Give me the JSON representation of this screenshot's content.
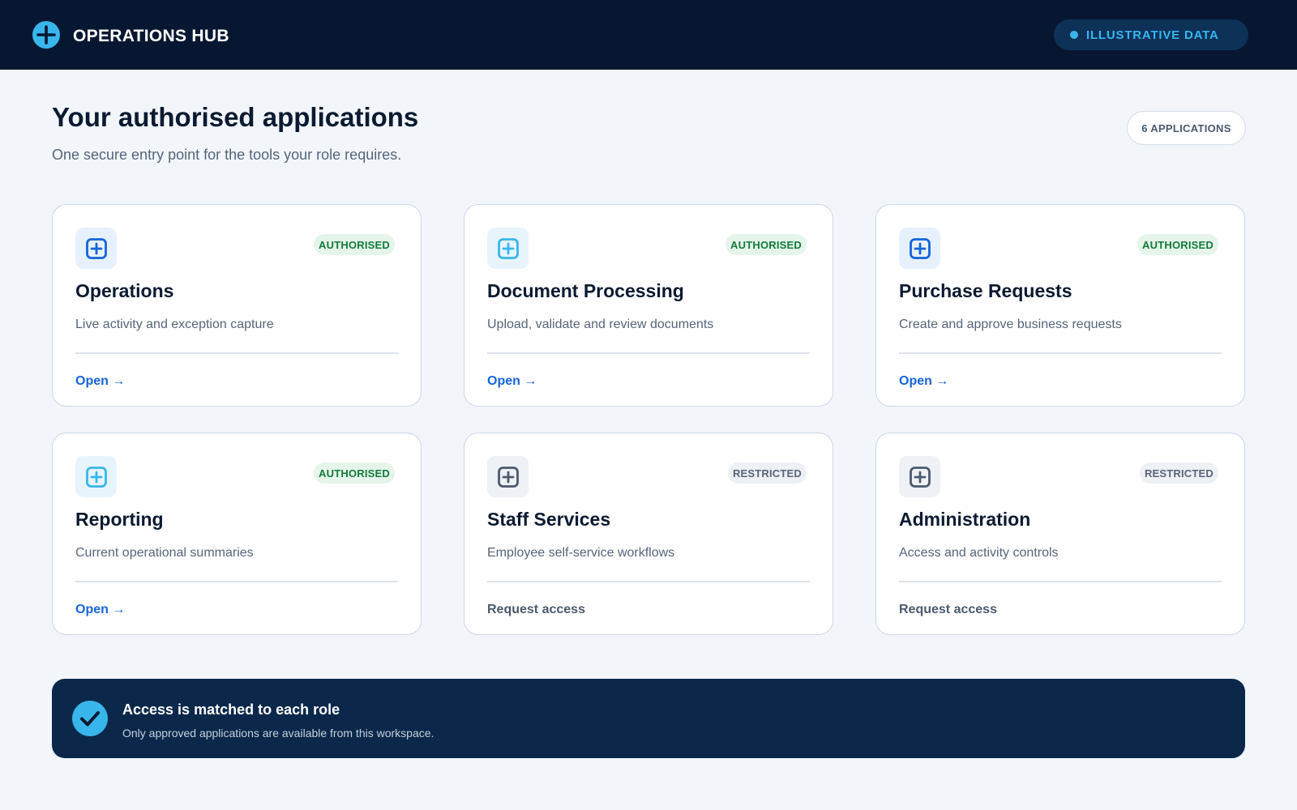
{
  "header": {
    "brand_icon": "plus-circle-icon",
    "brand_name": "OPERATIONS HUB",
    "data_badge": "ILLUSTRATIVE DATA"
  },
  "main": {
    "title": "Your authorised applications",
    "subtitle": "One secure entry point for the tools your role requires.",
    "count_badge": "6 APPLICATIONS"
  },
  "colors": {
    "header_bg": "#071731",
    "accent": "#38b6ec",
    "link": "#1565d8",
    "authorised_text": "#137a3c",
    "authorised_bg": "#e5f5ea",
    "restricted_text": "#5a6578",
    "restricted_bg": "#edf0f4",
    "notice_bg": "#0b284b"
  },
  "apps": [
    {
      "name": "Operations",
      "description": "Live activity and exception capture",
      "status": "AUTHORISED",
      "action": "Open →",
      "icon": "plus-square-icon"
    },
    {
      "name": "Document Processing",
      "description": "Upload, validate and review documents",
      "status": "AUTHORISED",
      "action": "Open →",
      "icon": "plus-square-icon"
    },
    {
      "name": "Purchase Requests",
      "description": "Create and approve business requests",
      "status": "AUTHORISED",
      "action": "Open →",
      "icon": "plus-square-icon"
    },
    {
      "name": "Reporting",
      "description": "Current operational summaries",
      "status": "AUTHORISED",
      "action": "Open →",
      "icon": "plus-square-icon"
    },
    {
      "name": "Staff Services",
      "description": "Employee self-service workflows",
      "status": "RESTRICTED",
      "action": "Request access",
      "icon": "plus-square-icon"
    },
    {
      "name": "Administration",
      "description": "Access and activity controls",
      "status": "RESTRICTED",
      "action": "Request access",
      "icon": "plus-square-icon"
    }
  ],
  "notice": {
    "icon": "check-circle-icon",
    "title": "Access is matched to each role",
    "subtitle": "Only approved applications are available from this workspace."
  }
}
